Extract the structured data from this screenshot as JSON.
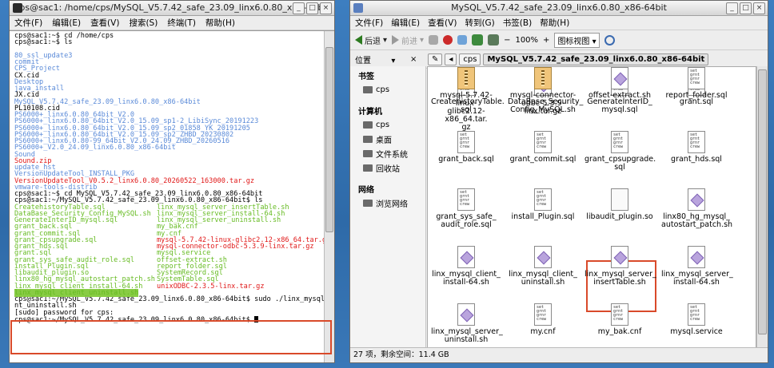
{
  "terminal": {
    "title": "cps@sac1: /home/cps/MySQL_V5.7.42_safe_23.09_linx6.0.80_x86-64bit",
    "menu": [
      "文件(F)",
      "编辑(E)",
      "查看(V)",
      "搜索(S)",
      "终端(T)",
      "帮助(H)"
    ],
    "lines": [
      {
        "t": "cps@sac1:~$ cd /home/cps",
        "c": "default"
      },
      {
        "t": "cps@sac1:~$ ls",
        "c": "default"
      },
      {
        "t": "",
        "c": "default"
      },
      {
        "t": "80_ssl_update3",
        "c": "blue"
      },
      {
        "t": "commit",
        "c": "blue"
      },
      {
        "t": "CPS_Project",
        "c": "blue"
      },
      {
        "t": "CX.cid",
        "c": "default"
      },
      {
        "t": "Desktop",
        "c": "blue"
      },
      {
        "t": "java_install",
        "c": "blue"
      },
      {
        "t": "JX.cid",
        "c": "default"
      },
      {
        "t": "MySQL_V5.7.42_safe_23.09_linx6.0.80_x86-64bit",
        "c": "blue"
      },
      {
        "t": "PL10108.cid",
        "c": "default"
      },
      {
        "t": "PS6000+_linx6.0.80_64bit_V2.0",
        "c": "blue"
      },
      {
        "t": "PS6000+_linx6.0.80_64bit_V2.0_15.09_sp1-2_LibiSync_20191223",
        "c": "blue"
      },
      {
        "t": "PS6000+_linx6.0.80_64bit_V2.0_15.09_sp2_01858_YK_20191205",
        "c": "blue"
      },
      {
        "t": "PS6000+_linx6.0.80_64bit_V2.0_15.09_sp2_ZHBD_20230802",
        "c": "blue"
      },
      {
        "t": "PS6000+_linx6.0.80-99_64bit_V2.0_24.09_ZHBD_20260516",
        "c": "blue"
      },
      {
        "t": "PS6000+_V2.0_24.09_linx6.0.80_x86-64bit",
        "c": "blue"
      },
      {
        "t": "Sound",
        "c": "blue"
      },
      {
        "t": "Sound.zip",
        "c": "red"
      },
      {
        "t": "update_hst",
        "c": "blue"
      },
      {
        "t": "VersionUpdateTool_INSTALL_PKG",
        "c": "blue"
      },
      {
        "t": "VersionUpdateTool_V0.5.2_linx6.0.80_20260522_163000.tar.gz",
        "c": "red"
      },
      {
        "t": "vmware-tools-distrib",
        "c": "blue"
      },
      {
        "t": "cps@sac1:~$ cd MySQL_V5.7.42_safe_23.09_linx6.0.80_x86-64bit",
        "c": "default"
      },
      {
        "t": "cps@sac1:~/MySQL_V5.7.42_safe_23.09_linx6.0.80_x86-64bit$ ls",
        "c": "default"
      }
    ],
    "ls_rows": [
      [
        "CreatehistoryTable.sql",
        "linx_mysql_server_insertTable.sh"
      ],
      [
        "DataBase_Security_Config_MySQL.sh",
        "linx_mysql_server_install-64.sh"
      ],
      [
        "GenerateInterID_mysql.sql",
        "linx_mysql_server_uninstall.sh"
      ],
      [
        "grant_back.sql",
        "my_bak.cnf"
      ],
      [
        "grant_commit.sql",
        "my.cnf"
      ],
      [
        "grant_cpsupgrade.sql",
        "mysql-5.7.42-linux-glibc2.12-x86_64.tar.gz"
      ],
      [
        "grant_hds.sql",
        "mysql-connector-odbc-5.3.9-linx.tar.gz"
      ],
      [
        "grant.sql",
        "mysql.service"
      ],
      [
        "grant_sys_safe_audit_role.sql",
        "offset-extract.sh"
      ],
      [
        "install_Plugin.sql",
        "report_folder.sql"
      ],
      [
        "libaudit_plugin.so",
        "SystemRecord.sql"
      ],
      [
        "linx80_hg_mysql_autostart_patch.sh",
        "SystemTable.sql"
      ],
      [
        "linx_mysql_client_install-64.sh",
        "unixODBC-2.3.5-linx.tar.gz"
      ],
      [
        "linx_mysql_client_uninstall.sh",
        ""
      ]
    ],
    "ls_colors": [
      [
        "green",
        "green"
      ],
      [
        "green",
        "green"
      ],
      [
        "green",
        "green"
      ],
      [
        "green",
        "green"
      ],
      [
        "green",
        "green"
      ],
      [
        "green",
        "red"
      ],
      [
        "green",
        "red"
      ],
      [
        "green",
        "green"
      ],
      [
        "green",
        "green"
      ],
      [
        "green",
        "green"
      ],
      [
        "green",
        "green"
      ],
      [
        "green",
        "green"
      ],
      [
        "green",
        "red"
      ],
      [
        "blink",
        ""
      ]
    ],
    "tail": [
      "cps@sac1:~/MySQL_V5.7.42_safe_23.09_linx6.0.80_x86-64bit$ sudo ./linx_mysql_clie",
      "nt_uninstall.sh",
      "[sudo] password for cps:",
      "cps@sac1:~/MySQL_V5.7.42_safe_23.09_linx6.0.80_x86-64bit$ "
    ]
  },
  "file_manager": {
    "title": "MySQL_V5.7.42_safe_23.09_linx6.0.80_x86-64bit",
    "menu": [
      "文件(F)",
      "编辑(E)",
      "查看(V)",
      "转到(G)",
      "书签(B)",
      "帮助(H)"
    ],
    "toolbar": {
      "back": "后退",
      "forward": "前进",
      "zoom": "100%",
      "view": "图标视图"
    },
    "places_label": "位置",
    "crumbs": [
      "cps",
      "MySQL_V5.7.42_safe_23.09_linx6.0.80_x86-64bit"
    ],
    "sidebar": [
      {
        "header": "书签",
        "items": [
          "cps"
        ]
      },
      {
        "header": "计算机",
        "items": [
          "cps",
          "桌面",
          "文件系统",
          "回收站"
        ]
      },
      {
        "header": "网络",
        "items": [
          "浏览网络"
        ]
      }
    ],
    "files": [
      {
        "n": [
          "CreatehistoryTable.",
          "sql"
        ],
        "k": "txt"
      },
      {
        "n": [
          "DataBase_Security_",
          "Config_MySQL.sh"
        ],
        "k": "sh"
      },
      {
        "n": [
          "GenerateInterID_",
          "mysql.sql"
        ],
        "k": "txt"
      },
      {
        "n": [
          "grant.sql"
        ],
        "k": "txt"
      },
      {
        "n": [
          "grant_back.sql"
        ],
        "k": "txt"
      },
      {
        "n": [
          "grant_commit.sql"
        ],
        "k": "txt"
      },
      {
        "n": [
          "grant_cpsupgrade.",
          "sql"
        ],
        "k": "txt"
      },
      {
        "n": [
          "grant_hds.sql"
        ],
        "k": "txt"
      },
      {
        "n": [
          "grant_sys_safe_",
          "audit_role.sql"
        ],
        "k": "txt"
      },
      {
        "n": [
          "install_Plugin.sql"
        ],
        "k": "txt"
      },
      {
        "n": [
          "libaudit_plugin.so"
        ],
        "k": "blank"
      },
      {
        "n": [
          "linx80_hg_mysql_",
          "autostart_patch.sh"
        ],
        "k": "sh"
      },
      {
        "n": [
          "linx_mysql_client_",
          "install-64.sh"
        ],
        "k": "sh"
      },
      {
        "n": [
          "linx_mysql_client_",
          "uninstall.sh"
        ],
        "k": "sh"
      },
      {
        "n": [
          "linx_mysql_server_",
          "insertTable.sh"
        ],
        "k": "sh"
      },
      {
        "n": [
          "linx_mysql_server_",
          "install-64.sh"
        ],
        "k": "sh"
      },
      {
        "n": [
          "linx_mysql_server_",
          "uninstall.sh"
        ],
        "k": "sh"
      },
      {
        "n": [
          "my.cnf"
        ],
        "k": "txt"
      },
      {
        "n": [
          "my_bak.cnf"
        ],
        "k": "txt"
      },
      {
        "n": [
          "mysql.service"
        ],
        "k": "txt"
      },
      {
        "n": [
          "mysql-5.7.42-linux-",
          "glibc2.12-x86_64.tar.",
          "gz"
        ],
        "k": "gz"
      },
      {
        "n": [
          "mysql-connector-",
          "odbc-5.3.9-linx.tar.gz"
        ],
        "k": "gz"
      },
      {
        "n": [
          "offset-extract.sh"
        ],
        "k": "sh"
      },
      {
        "n": [
          "report_folder.sql"
        ],
        "k": "txt"
      }
    ],
    "status": "27 项，剩余空间：11.4 GB"
  }
}
